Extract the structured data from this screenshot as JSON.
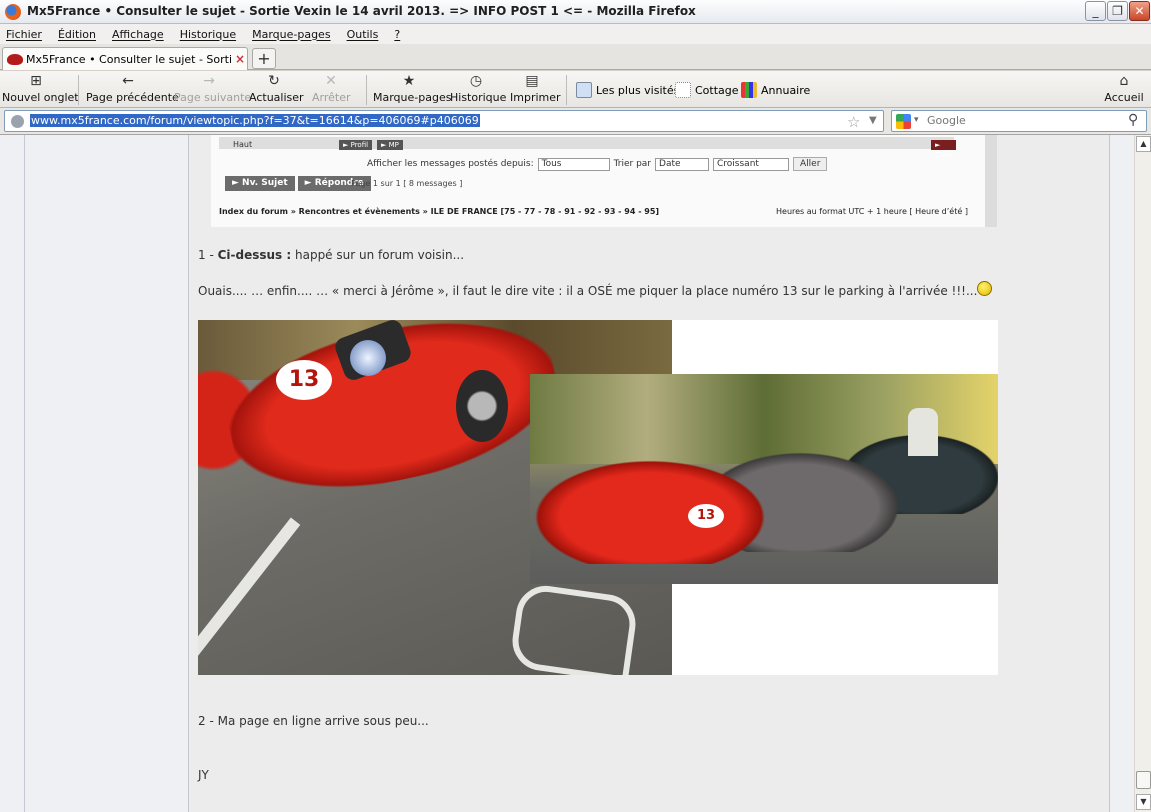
{
  "window": {
    "title": "Mx5France • Consulter le sujet - Sortie Vexin le 14 avril 2013. => INFO POST 1 <= - Mozilla Firefox",
    "min": "_",
    "max": "❐",
    "close": "✕"
  },
  "menu": [
    "Fichier",
    "Édition",
    "Affichage",
    "Historique",
    "Marque-pages",
    "Outils",
    "?"
  ],
  "tab": {
    "label": "Mx5France • Consulter le sujet - Sortie Vexi...",
    "close": "×",
    "new": "+"
  },
  "nav": {
    "new_tab": "Nouvel onglet",
    "back": "Page précédente",
    "forward": "Page suivante",
    "reload": "Actualiser",
    "stop": "Arrêter",
    "bookmarks": "Marque-pages",
    "history": "Historique",
    "print": "Imprimer",
    "home": "Accueil"
  },
  "bookmarks_bar": [
    "Les plus visités",
    "Cottage",
    "Annuaire"
  ],
  "url": "www.mx5france.com/forum/viewtopic.php?f=37&t=16614&p=406069#p406069",
  "search": {
    "placeholder": "Google"
  },
  "quoted_block": {
    "haut": "Haut",
    "profil": "► Profil",
    "mp": "► MP",
    "citer": "► Citer",
    "filter_label": "Afficher les messages postés depuis:",
    "filter_value": "Tous",
    "sort_label": "Trier par",
    "sort_value": "Date",
    "order_value": "Croissant",
    "go": "Aller",
    "new_topic": "► Nv. Sujet",
    "reply": "► Répondre",
    "pages": "Page 1 sur 1   [ 8 messages ]",
    "breadcrumb": "Index du forum » Rencontres et évènements » ILE DE FRANCE [75 - 77 - 78 - 91 - 92 - 93 - 94 - 95]",
    "timezone": "Heures au format UTC + 1 heure [ Heure d’été ]"
  },
  "post": {
    "line1_prefix": "1 - ",
    "line1_bold": "Ci-dessus :",
    "line1_rest": " happé sur un forum voisin...",
    "line2": "Ouais.... … enfin.... … « merci à Jérôme », il faut le dire vite : il a OSÉ me piquer la place numéro 13 sur le parking à l'arrivée !!!...",
    "roundel_number": "13",
    "line3": "2 - Ma page en ligne arrive sous peu...",
    "signature": "JY"
  },
  "scrollbar": {
    "up": "▲",
    "down": "▼"
  }
}
